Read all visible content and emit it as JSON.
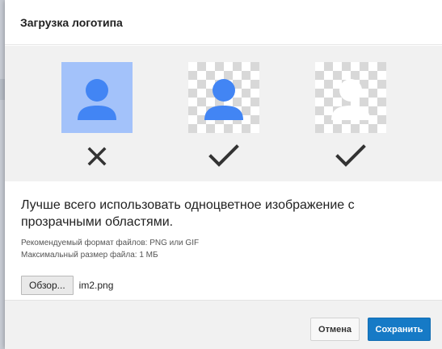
{
  "dialog": {
    "title": "Загрузка логотипа",
    "examples": [
      {
        "icon": "person-icon",
        "icon_color": "#4285f4",
        "background": "blue",
        "verdict": "cross-icon"
      },
      {
        "icon": "person-icon",
        "icon_color": "#4285f4",
        "background": "transparent",
        "verdict": "checkmark-icon"
      },
      {
        "icon": "person-icon",
        "icon_color": "#ffffff",
        "background": "transparent",
        "verdict": "checkmark-icon"
      }
    ],
    "headline": "Лучше всего использовать одноцветное изображение с прозрачными областями.",
    "format_hint": "Рекомендуемый формат файлов: PNG или GIF",
    "size_hint": "Максимальный размер файла: 1 МБ",
    "browse_label": "Обзор...",
    "file_name": "im2.png",
    "cancel_label": "Отмена",
    "save_label": "Сохранить"
  },
  "colors": {
    "accent": "#167ac6",
    "example_blue_background": "#a3c2fa",
    "mark": "#333333"
  }
}
